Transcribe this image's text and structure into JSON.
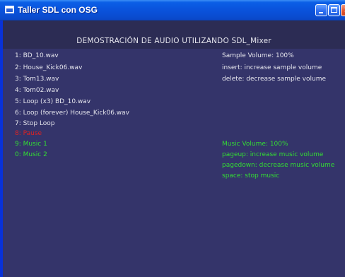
{
  "window": {
    "title": "Taller SDL con OSG"
  },
  "header": {
    "heading": "DEMOSTRACIÓN DE AUDIO UTILIZANDO SDL_Mixer"
  },
  "menu": {
    "items": [
      "1: BD_10.wav",
      "2: House_Kick06.wav",
      "3: Tom13.wav",
      "4: Tom02.wav",
      "5: Loop (x3) BD_10.wav",
      "6: Loop (forever) House_Kick06.wav",
      "7: Stop Loop",
      "8: Pause",
      "9: Music 1",
      "0: Music 2"
    ]
  },
  "sample": {
    "volume": "Sample Volume: 100%",
    "insert_hint": "insert: increase sample volume",
    "delete_hint": "delete: decrease sample volume"
  },
  "music": {
    "volume": "Music Volume: 100%",
    "pageup_hint": "pageup: increase music volume",
    "pagedown_hint": "pagedown: decrease music volume",
    "space_hint": "space: stop music"
  },
  "colors": {
    "background": "#34346a",
    "header_band": "#2c2c54",
    "text": "#e4e4ec",
    "music_text": "#33dd33",
    "paused_text": "#dd2222"
  }
}
